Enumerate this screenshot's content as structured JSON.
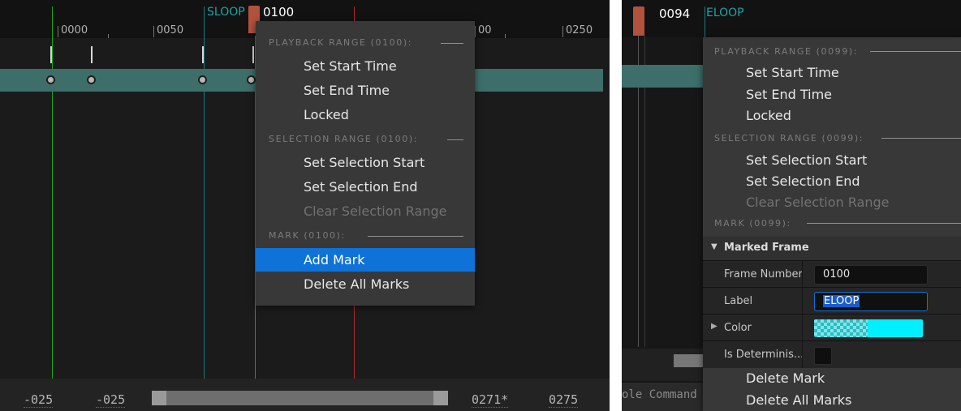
{
  "left": {
    "ruler_ticks": [
      "0000",
      "0050",
      "0100",
      "0250"
    ],
    "loop_label": "SLOOP",
    "playhead": "0100",
    "bottom": {
      "start_a": "-025",
      "start_b": "-025",
      "end_a": "0271*",
      "end_b": "0275"
    },
    "menu": {
      "playback_header": "PLAYBACK RANGE (0100):",
      "set_start": "Set Start Time",
      "set_end": "Set End Time",
      "locked": "Locked",
      "selection_header": "SELECTION RANGE (0100):",
      "sel_start": "Set Selection Start",
      "sel_end": "Set Selection End",
      "clear_sel": "Clear Selection Range",
      "mark_header": "MARK (0100):",
      "add_mark": "Add Mark",
      "delete_all": "Delete All Marks"
    }
  },
  "right": {
    "playhead": "0094",
    "loop_label": "ELOOP",
    "console_text": "ole Command",
    "menu": {
      "playback_header": "PLAYBACK RANGE (0099):",
      "set_start": "Set Start Time",
      "set_end": "Set End Time",
      "locked": "Locked",
      "selection_header": "SELECTION RANGE (0099):",
      "sel_start": "Set Selection Start",
      "sel_end": "Set Selection End",
      "clear_sel": "Clear Selection Range",
      "mark_header": "MARK (0099):",
      "details": {
        "title": "Marked Frame",
        "frame_number_label": "Frame Number",
        "frame_number_value": "0100",
        "label_label": "Label",
        "label_value": "ELOOP",
        "color_label": "Color",
        "color_value": "#00f0ff",
        "deterministic_label": "Is Determinis..."
      },
      "delete_mark": "Delete Mark",
      "delete_all": "Delete All Marks"
    }
  }
}
